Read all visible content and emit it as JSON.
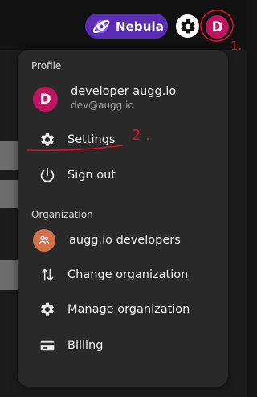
{
  "topbar": {
    "workspace_badge": {
      "label": "Nebula",
      "color": "#5a2eb3",
      "icon": "nebula-planet-icon"
    },
    "settings_button": {
      "icon": "gear-icon"
    },
    "user_avatar": {
      "initial": "D",
      "color": "#c0155e"
    }
  },
  "menu": {
    "profile_section": {
      "label": "Profile",
      "user": {
        "initial": "D",
        "name": "developer augg.io",
        "email": "dev@augg.io",
        "avatar_color": "#c0155e"
      },
      "items": [
        {
          "label": "Settings",
          "icon": "gear-icon"
        },
        {
          "label": "Sign out",
          "icon": "power-icon"
        }
      ]
    },
    "organization_section": {
      "label": "Organization",
      "current": {
        "name": "augg.io developers",
        "icon": "group-icon",
        "avatar_color": "#d4714a"
      },
      "items": [
        {
          "label": "Change organization",
          "icon": "swap-vertical-icon"
        },
        {
          "label": "Manage organization",
          "icon": "gear-icon"
        },
        {
          "label": "Billing",
          "icon": "credit-card-icon"
        }
      ]
    }
  },
  "annotations": {
    "marker_1": "1.",
    "marker_2": "2 .",
    "color": "#e0102a"
  }
}
